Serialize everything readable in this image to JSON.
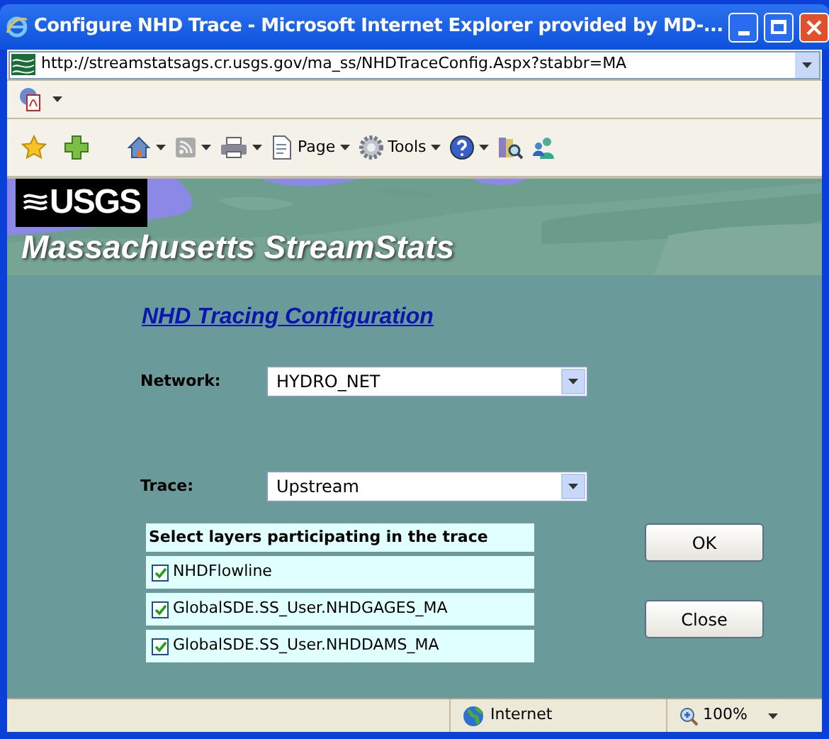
{
  "window": {
    "title": "Configure NHD Trace - Microsoft Internet Explorer provided by MD-..."
  },
  "address_bar": {
    "url": "http://streamstatsags.cr.usgs.gov/ma_ss/NHDTraceConfig.Aspx?stabbr=MA"
  },
  "command_bar": [
    {
      "kind": "home"
    },
    {
      "kind": "feeds"
    },
    {
      "kind": "print"
    },
    {
      "kind": "page",
      "label": "Page"
    },
    {
      "kind": "tools",
      "label": "Tools"
    },
    {
      "kind": "help"
    },
    {
      "kind": "research"
    },
    {
      "kind": "messenger"
    }
  ],
  "banner": {
    "logo": "USGS",
    "title": "Massachusetts StreamStats"
  },
  "heading": "NHD Tracing Configuration",
  "fields": [
    {
      "label": "Network:",
      "value": "HYDRO_NET"
    },
    {
      "label": "Trace:",
      "value": "Upstream"
    }
  ],
  "layers": {
    "header": "Select layers participating in the trace",
    "items": [
      {
        "name": "NHDFlowline",
        "checked": true
      },
      {
        "name": "GlobalSDE.SS_User.NHDGAGES_MA",
        "checked": true
      },
      {
        "name": "GlobalSDE.SS_User.NHDDAMS_MA",
        "checked": true
      }
    ]
  },
  "buttons": [
    "OK",
    "Close"
  ],
  "status_bar": {
    "zone": "Internet",
    "zoom": "100%"
  }
}
